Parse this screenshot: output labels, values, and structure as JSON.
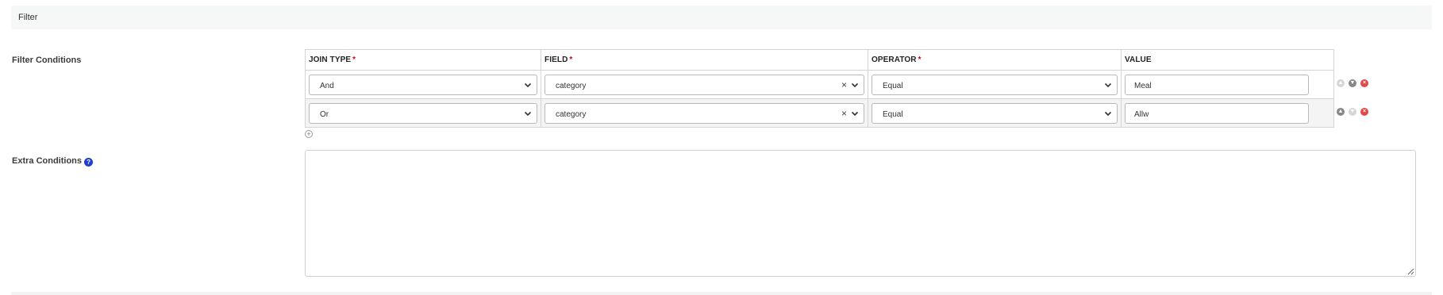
{
  "section": {
    "title": "Filter"
  },
  "labels": {
    "filter_conditions": "Filter Conditions",
    "extra_conditions": "Extra Conditions",
    "help_icon": "?"
  },
  "table": {
    "headers": {
      "join_type": "JOIN TYPE",
      "field": "FIELD",
      "operator": "OPERATOR",
      "value": "VALUE",
      "required_mark": "*"
    },
    "rows": [
      {
        "join_type": "And",
        "field": "category",
        "operator": "Equal",
        "value": "Meal"
      },
      {
        "join_type": "Or",
        "field": "category",
        "operator": "Equal",
        "value": "Allw"
      }
    ]
  },
  "icons": {
    "add": "+",
    "clear": "×",
    "move_up": "▲",
    "move_down": "▼",
    "remove": "×"
  },
  "extra_conditions": {
    "value": ""
  },
  "colors": {
    "required": "#d0021b",
    "help_icon": "#1f3fd1",
    "remove_button": "#e34848"
  }
}
